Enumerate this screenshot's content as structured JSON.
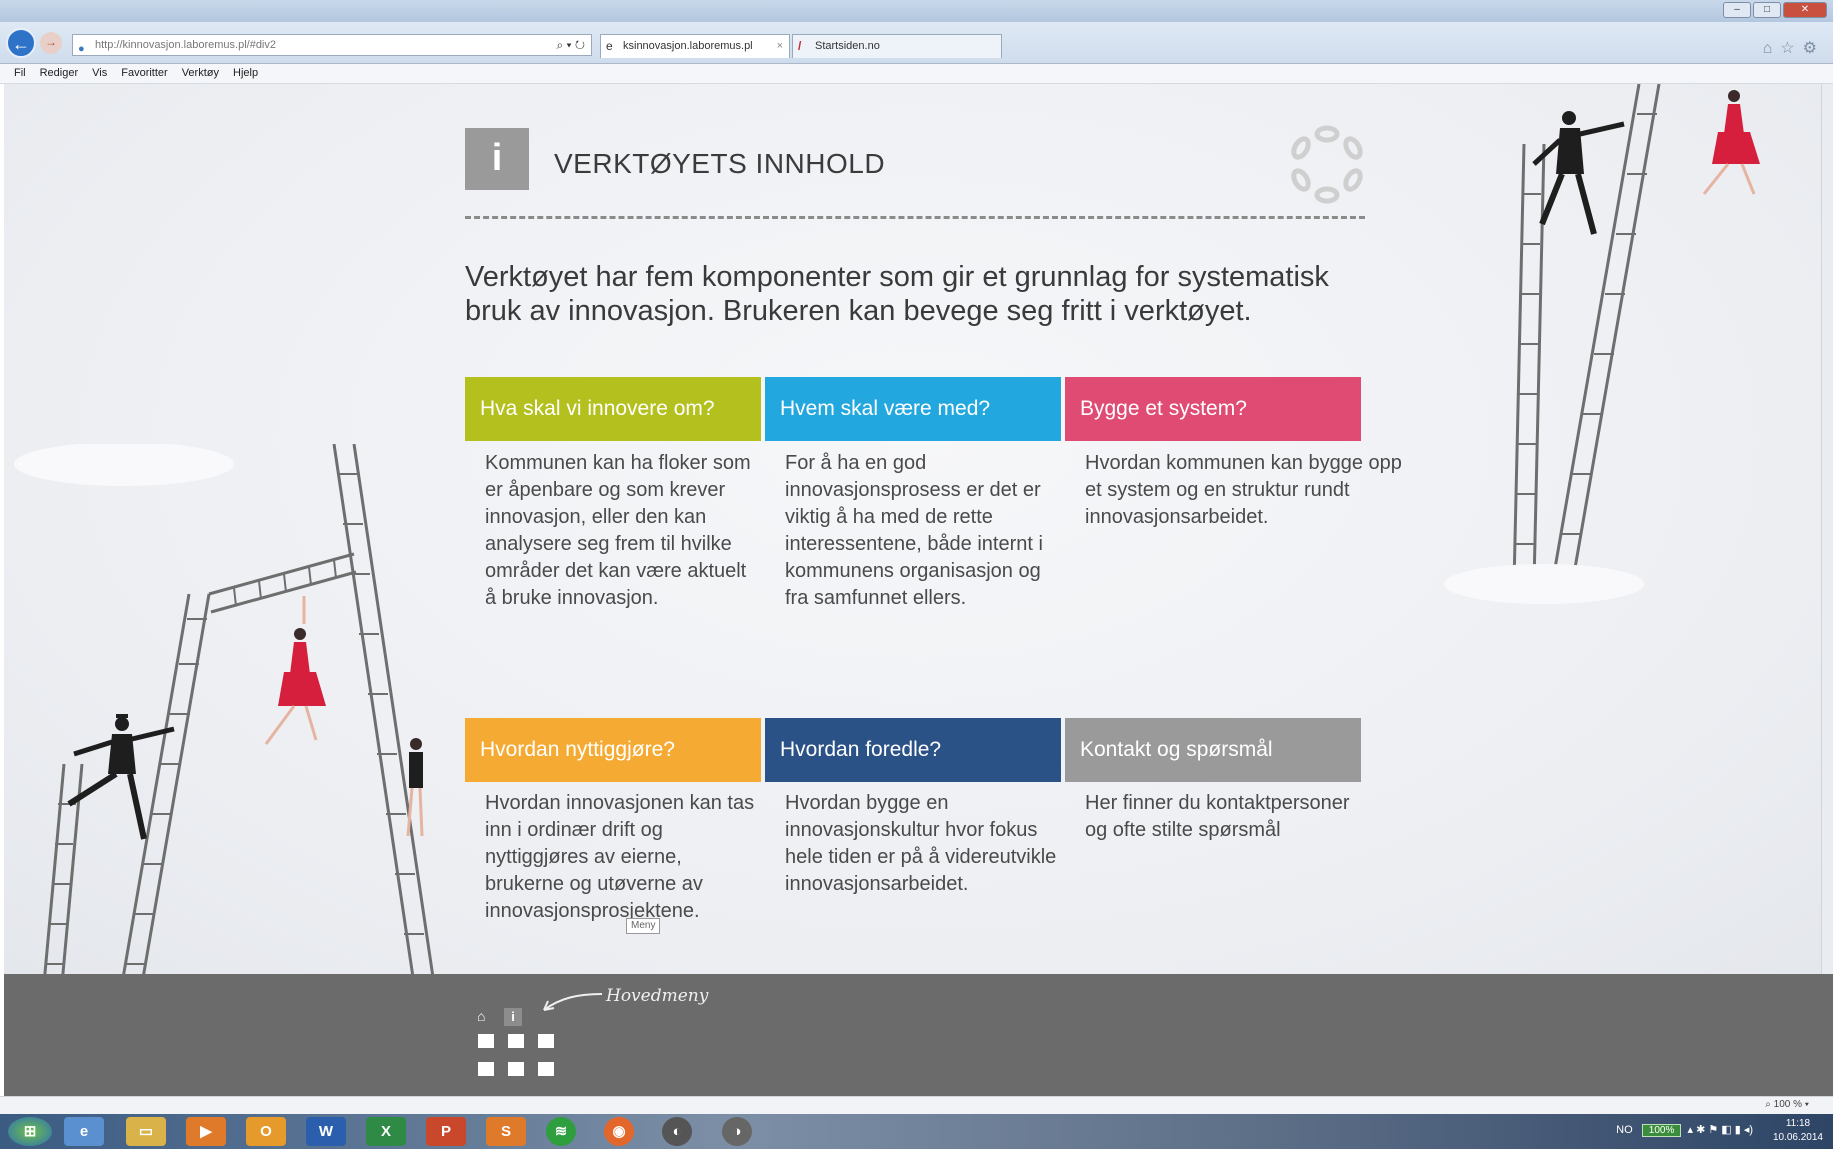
{
  "browser": {
    "address": "http://kinnovasjon.laboremus.pl/#div2",
    "tabs": [
      {
        "label": "ksinnovasjon.laboremus.pl",
        "close": "×"
      },
      {
        "label": "Startsiden.no"
      }
    ],
    "menu": [
      "Fil",
      "Rediger",
      "Vis",
      "Favoritter",
      "Verktøy",
      "Hjelp"
    ]
  },
  "header": {
    "icon_letter": "i",
    "title": "VERKTØYETS INNHOLD"
  },
  "intro": "Verktøyet har fem komponenter som gir et grunnlag for systematisk bruk av innovasjon. Brukeren kan bevege seg fritt i verktøyet.",
  "cards": [
    {
      "title": "Hva skal vi innovere om?",
      "text": "Kommunen kan ha floker som er åpenbare og som krever innovasjon, eller den kan analysere seg frem til hvilke områder det kan være aktuelt å bruke innovasjon.",
      "color": "#b3c01e"
    },
    {
      "title": "Hvem skal være med?",
      "text": "For å ha en god innovasjonsprosess er det er viktig å ha med de rette interessentene, både internt i kommunens organisasjon og fra samfunnet ellers.",
      "color": "#23a7df"
    },
    {
      "title": "Bygge et system?",
      "text": "Hvordan kommunen kan bygge opp et system og en struktur rundt innovasjonsarbeidet.",
      "color": "#df4b72"
    },
    {
      "title": "Hvordan nyttiggjøre?",
      "text": "Hvordan innovasjonen kan tas inn i ordinær drift og nyttiggjøres av eierne, brukerne og utøverne av innovasjonsprosjektene.",
      "color": "#f5ab33"
    },
    {
      "title": "Hvordan foredle?",
      "text": "Hvordan bygge en innovasjonskultur hvor fokus hele tiden er på å videreutvikle innovasjonsarbeidet.",
      "color": "#2a5286"
    },
    {
      "title": "Kontakt og spørsmål",
      "text": "Her finner du kontaktpersoner og ofte stilte spørsmål",
      "color": "#9a9a9a"
    }
  ],
  "tooltip": "Meny",
  "footer": {
    "label": "Hovedmeny",
    "info_letter": "i"
  },
  "status": {
    "zoom": "100 %"
  },
  "taskbar": {
    "tray_lang": "NO",
    "tray_battery": "100%",
    "time": "11:18",
    "date": "10.06.2014"
  }
}
